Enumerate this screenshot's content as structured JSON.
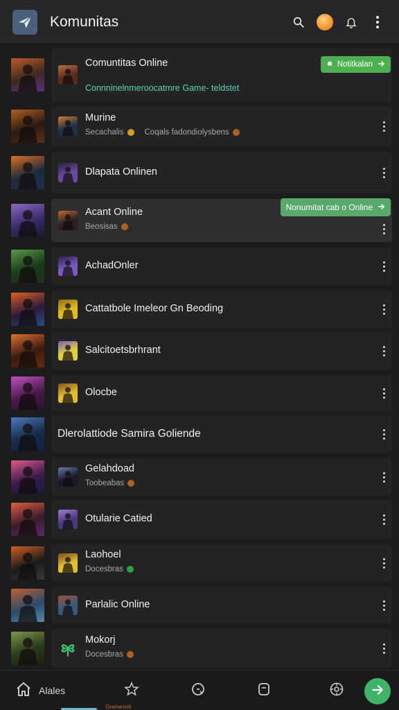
{
  "appbar": {
    "title": "Komunitas",
    "logo_icon": "paper-plane-icon",
    "actions": [
      "search-icon",
      "emoji-avatar",
      "bell-icon",
      "more-vert-icon"
    ],
    "brand_color": "#4a5f78"
  },
  "rows": [
    {
      "title": "Comuntitas Online",
      "subtitle": "Connninelnmeroocatmre Game- teldstet",
      "subtitle_style": "teal",
      "pill": "Notitkalan",
      "cover_colors": [
        "#3a2a20",
        "#c05a2a",
        "#5a3080"
      ],
      "thumb_colors": [
        "#5a2a20",
        "#c07040"
      ]
    },
    {
      "title": "Murine",
      "subtitle": "Secachalis",
      "subtitle_extra": "Coqals fadondiolysbens",
      "dot_color": "#d4a020",
      "cover_colors": [
        "#2a1a10",
        "#b06020",
        "#603018"
      ],
      "thumb_colors": [
        "#20304a",
        "#d08030"
      ]
    },
    {
      "title": "Dlapata Onlinen",
      "subtitle": "",
      "wide": false,
      "cover_colors": [
        "#1a2a3a",
        "#e07020",
        "#203050"
      ],
      "thumb_colors": [
        "#6a4aa0",
        "#2a2040"
      ]
    },
    {
      "title": "Acant Online",
      "subtitle": "Beosisas",
      "dot_color": "#b06020",
      "highlight": true,
      "pill": "Nonumitat cab o Online",
      "cover_colors": [
        "#3a2a6a",
        "#8a6ac0",
        "#1a1a30"
      ],
      "thumb_colors": [
        "#2a2020",
        "#c06a30"
      ]
    },
    {
      "title": "AchadOnler",
      "subtitle": "",
      "cover_colors": [
        "#1a3a1a",
        "#5a9a4a",
        "#20301a"
      ],
      "thumb_colors": [
        "#7a5ac0",
        "#302050"
      ]
    },
    {
      "title": "Cattatbole Imeleor Gn Beoding",
      "subtitle": "",
      "cover_colors": [
        "#2a1a3a",
        "#e06020",
        "#2a4a8a"
      ],
      "thumb_colors": [
        "#e0c020",
        "#8a6a10"
      ]
    },
    {
      "title": "Salcitoetsbrhrant",
      "subtitle": "",
      "cover_colors": [
        "#3a1a10",
        "#e07030",
        "#6a2a10"
      ],
      "thumb_colors": [
        "#e0d040",
        "#7a5ac0"
      ]
    },
    {
      "title": "Olocbe",
      "subtitle": "",
      "cover_colors": [
        "#4a1a4a",
        "#c050c0",
        "#2a1030"
      ],
      "thumb_colors": [
        "#e0c030",
        "#8a5020"
      ]
    },
    {
      "title": "Dlerolattiode Samira Goliende",
      "subtitle": "",
      "wide": true,
      "cover_colors": [
        "#1a2a4a",
        "#4a7ac0",
        "#102040"
      ],
      "thumb_colors": []
    },
    {
      "title": "Gelahdoad",
      "subtitle": "Toobeabas",
      "dot_color": "#b06020",
      "cover_colors": [
        "#3a1a4a",
        "#e05a8a",
        "#1a1a3a"
      ],
      "thumb_colors": [
        "#1a1a2a",
        "#6a7ab0"
      ]
    },
    {
      "title": "Otularie Catied",
      "subtitle": "",
      "cover_colors": [
        "#3a1a2a",
        "#e06040",
        "#5a2a6a"
      ],
      "thumb_colors": [
        "#4a3a7a",
        "#a07ad0"
      ]
    },
    {
      "title": "Laohoel",
      "subtitle": "Docesbras",
      "dot_color": "#30a040",
      "dot_shape": "heart",
      "cover_colors": [
        "#1a1a1a",
        "#d06020",
        "#3a3a3a"
      ],
      "thumb_colors": [
        "#e0c030",
        "#7a4a20"
      ]
    },
    {
      "title": "Parlalic Online",
      "subtitle": "",
      "cover_colors": [
        "#2a4a6a",
        "#c06030",
        "#5a8ab0"
      ],
      "thumb_colors": [
        "#3a5a7a",
        "#a0503a"
      ]
    },
    {
      "title": "Mokorj",
      "subtitle": "Docesbras",
      "dot_color": "#b06020",
      "cover_colors": [
        "#2a3a1a",
        "#7a9a4a",
        "#1a2010"
      ],
      "thumb_colors": []
    }
  ],
  "bottom_nav": {
    "home_label": "Alales",
    "items": [
      "home-icon",
      "star-badge-icon",
      "search-icon",
      "cup-icon",
      "settings-icon"
    ],
    "fab_icon": "send-icon",
    "accent_color": "#3fb36a",
    "tiny_text": "Grameoolt"
  }
}
